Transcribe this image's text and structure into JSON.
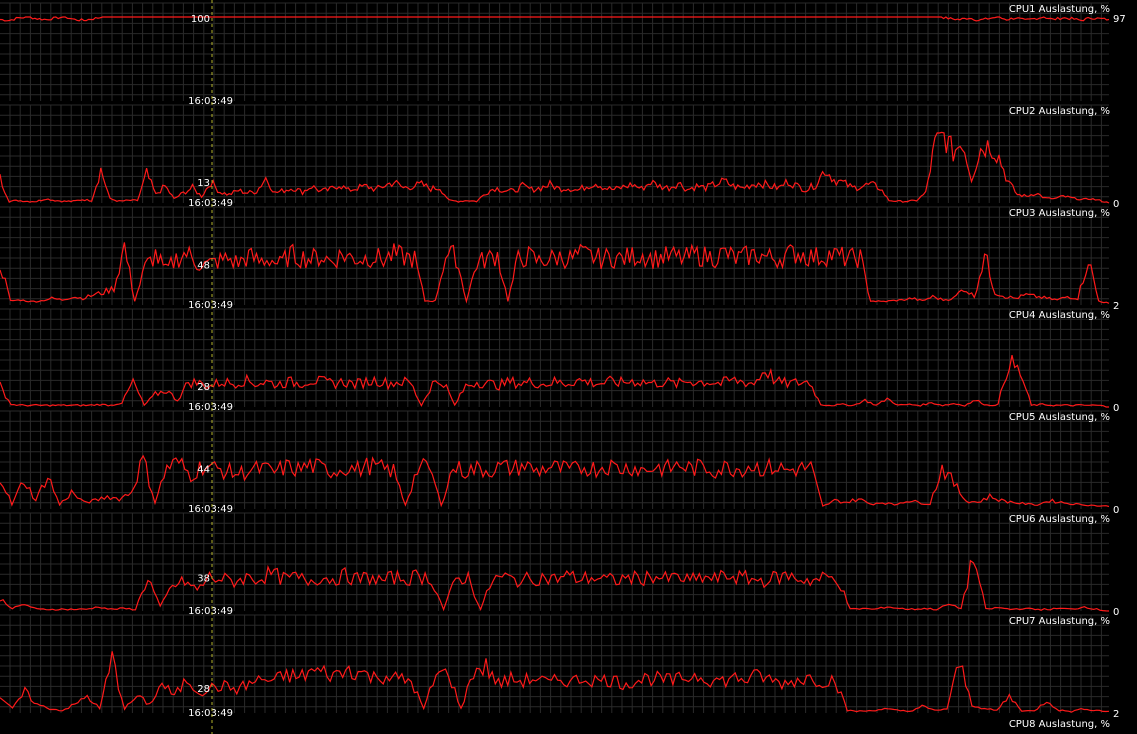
{
  "colors": {
    "background": "#000000",
    "grid": "#2a2a2a",
    "line": "#ff1a1a",
    "text": "#ffffff",
    "cursor": "#b5b52a"
  },
  "cursor": {
    "time": "16:03:49"
  },
  "chart_data": [
    {
      "type": "line",
      "title": "CPU1 Auslastung, %",
      "ylim": [
        0,
        100
      ],
      "current_value": "97",
      "cursor_value": "100",
      "cursor_time": "16:03:49",
      "grid": true,
      "profile": "flat",
      "series": [
        {
          "values": [
            97,
            96,
            99,
            100,
            98,
            97,
            99,
            100,
            97,
            96,
            98,
            100,
            100,
            100,
            100,
            100,
            100,
            100,
            100,
            100,
            100,
            100,
            100,
            100,
            100,
            100,
            100,
            100,
            100,
            100,
            100,
            100,
            100,
            100,
            100,
            100,
            100,
            100,
            100,
            100,
            100,
            100,
            100,
            100,
            100,
            100,
            100,
            100,
            100,
            100,
            100,
            100,
            100,
            100,
            100,
            100,
            100,
            100,
            100,
            100,
            100,
            100,
            100,
            100,
            100,
            100,
            100,
            100,
            100,
            100,
            100,
            100,
            100,
            100,
            100,
            100,
            100,
            100,
            100,
            100,
            100,
            100,
            100,
            100,
            100,
            100,
            100,
            100,
            100,
            100,
            100,
            100,
            100,
            100,
            100,
            100,
            100,
            100,
            100,
            100,
            100,
            100,
            98,
            97,
            99,
            96,
            98,
            100,
            97,
            99,
            96,
            98,
            100,
            97,
            99,
            98,
            96,
            99,
            98,
            97
          ]
        }
      ]
    },
    {
      "type": "line",
      "title": "CPU2 Auslastung, %",
      "ylim": [
        0,
        100
      ],
      "current_value": "0",
      "cursor_value": "13",
      "cursor_time": "16:03:49",
      "grid": true,
      "profile": "cpu2",
      "series": [
        {
          "values": [
            30,
            2,
            3,
            2,
            2,
            5,
            3,
            2,
            2,
            4,
            3,
            40,
            5,
            2,
            3,
            3,
            35,
            10,
            20,
            5,
            12,
            18,
            8,
            25,
            13,
            10,
            15,
            12,
            14,
            30,
            12,
            15,
            18,
            13,
            20,
            14,
            16,
            22,
            15,
            18,
            20,
            16,
            21,
            25,
            18,
            20,
            22,
            17,
            18,
            3,
            2,
            3,
            2,
            12,
            18,
            15,
            14,
            20,
            16,
            18,
            22,
            17,
            18,
            15,
            20,
            24,
            18,
            16,
            19,
            22,
            17,
            25,
            20,
            18,
            24,
            16,
            20,
            18,
            22,
            26,
            20,
            18,
            22,
            24,
            20,
            18,
            26,
            20,
            16,
            22,
            40,
            28,
            24,
            18,
            20,
            22,
            18,
            3,
            2,
            2,
            3,
            12,
            70,
            80,
            60,
            75,
            30,
            65,
            70,
            55,
            25,
            10,
            8,
            12,
            6,
            5,
            8,
            6,
            4,
            5,
            3,
            0
          ]
        }
      ]
    },
    {
      "type": "line",
      "title": "CPU3 Auslastung, %",
      "ylim": [
        0,
        100
      ],
      "current_value": "2",
      "cursor_value": "48",
      "cursor_time": "16:03:49",
      "grid": true,
      "profile": "cpu3",
      "series": [
        {
          "values": [
            50,
            5,
            6,
            4,
            5,
            8,
            6,
            10,
            8,
            12,
            15,
            20,
            70,
            5,
            45,
            60,
            40,
            55,
            62,
            50,
            48,
            52,
            55,
            50,
            58,
            52,
            55,
            48,
            60,
            57,
            55,
            58,
            52,
            60,
            56,
            55,
            58,
            54,
            60,
            57,
            55,
            5,
            5,
            60,
            58,
            5,
            50,
            55,
            60,
            5,
            55,
            58,
            52,
            55,
            57,
            55,
            60,
            58,
            55,
            57,
            55,
            58,
            60,
            55,
            57,
            58,
            55,
            60,
            58,
            57,
            62,
            55,
            58,
            60,
            57,
            55,
            60,
            62,
            58,
            57,
            60,
            58,
            55,
            57,
            5,
            4,
            5,
            6,
            8,
            5,
            10,
            6,
            8,
            20,
            10,
            60,
            15,
            10,
            8,
            12,
            10,
            8,
            6,
            10,
            8,
            55,
            5,
            2
          ]
        }
      ]
    },
    {
      "type": "line",
      "title": "CPU4 Auslastung, %",
      "ylim": [
        0,
        100
      ],
      "current_value": "0",
      "cursor_value": "28",
      "cursor_time": "16:03:49",
      "grid": true,
      "profile": "cpu4",
      "series": [
        {
          "values": [
            25,
            3,
            2,
            2,
            2,
            2,
            2,
            2,
            2,
            3,
            2,
            5,
            30,
            2,
            15,
            20,
            8,
            30,
            28,
            25,
            30,
            28,
            32,
            28,
            30,
            27,
            30,
            28,
            32,
            30,
            28,
            30,
            27,
            30,
            32,
            28,
            30,
            29,
            2,
            28,
            30,
            2,
            25,
            30,
            28,
            26,
            30,
            28,
            30,
            27,
            30,
            28,
            32,
            30,
            28,
            30,
            29,
            31,
            30,
            28,
            30,
            27,
            31,
            30,
            30,
            28,
            32,
            30,
            28,
            45,
            30,
            28,
            29,
            30,
            3,
            2,
            3,
            2,
            8,
            2,
            10,
            2,
            3,
            2,
            5,
            2,
            4,
            2,
            8,
            2,
            3,
            55,
            40,
            2,
            3,
            2,
            2,
            2,
            2,
            2,
            0
          ]
        }
      ]
    },
    {
      "type": "line",
      "title": "CPU5 Auslastung, %",
      "ylim": [
        0,
        100
      ],
      "current_value": "0",
      "cursor_value": "44",
      "cursor_time": "16:03:49",
      "grid": true,
      "profile": "cpu5",
      "series": [
        {
          "values": [
            40,
            5,
            35,
            10,
            40,
            5,
            20,
            8,
            10,
            15,
            12,
            20,
            60,
            8,
            50,
            55,
            40,
            52,
            48,
            45,
            42,
            46,
            48,
            44,
            50,
            47,
            52,
            48,
            45,
            50,
            47,
            52,
            48,
            45,
            5,
            48,
            50,
            5,
            50,
            45,
            48,
            46,
            50,
            48,
            52,
            45,
            50,
            48,
            46,
            50,
            48,
            52,
            48,
            50,
            46,
            50,
            48,
            52,
            48,
            50,
            46,
            50,
            48,
            52,
            48,
            50,
            46,
            48,
            50,
            3,
            10,
            8,
            12,
            6,
            8,
            5,
            10,
            8,
            6,
            50,
            30,
            10,
            8,
            15,
            10,
            8,
            6,
            5,
            10,
            8,
            6,
            5,
            4,
            3
          ]
        }
      ]
    },
    {
      "type": "line",
      "title": "CPU6 Auslastung, %",
      "ylim": [
        0,
        100
      ],
      "current_value": "0",
      "cursor_value": "38",
      "cursor_time": "16:03:49",
      "grid": true,
      "profile": "cpu6",
      "series": [
        {
          "values": [
            15,
            3,
            8,
            2,
            2,
            2,
            2,
            2,
            5,
            2,
            3,
            2,
            40,
            5,
            30,
            35,
            25,
            40,
            38,
            35,
            40,
            38,
            45,
            38,
            40,
            36,
            40,
            38,
            42,
            38,
            40,
            36,
            40,
            38,
            42,
            38,
            2,
            38,
            40,
            2,
            38,
            40,
            36,
            38,
            40,
            38,
            42,
            38,
            40,
            38,
            36,
            40,
            38,
            42,
            38,
            40,
            36,
            40,
            38,
            42,
            40,
            38,
            36,
            40,
            42,
            38,
            36,
            40,
            38,
            2,
            3,
            2,
            5,
            3,
            2,
            3,
            2,
            8,
            3,
            65,
            2,
            4,
            2,
            3,
            2,
            2,
            3,
            2,
            5,
            2,
            0
          ]
        }
      ]
    },
    {
      "type": "line",
      "title": "CPU7 Auslastung, %",
      "ylim": [
        0,
        100
      ],
      "current_value": "2",
      "cursor_value": "28",
      "cursor_time": "16:03:49",
      "grid": true,
      "profile": "cpu7",
      "series": [
        {
          "values": [
            20,
            5,
            25,
            10,
            5,
            3,
            10,
            20,
            5,
            65,
            5,
            20,
            10,
            35,
            20,
            40,
            25,
            30,
            32,
            28,
            35,
            40,
            38,
            45,
            42,
            50,
            48,
            45,
            52,
            48,
            42,
            45,
            40,
            38,
            5,
            45,
            48,
            5,
            50,
            55,
            35,
            40,
            38,
            42,
            35,
            40,
            38,
            42,
            38,
            40,
            35,
            38,
            42,
            40,
            38,
            42,
            45,
            40,
            38,
            42,
            40,
            45,
            38,
            35,
            40,
            42,
            38,
            40,
            3,
            2,
            3,
            5,
            3,
            2,
            8,
            3,
            5,
            60,
            10,
            5,
            3,
            20,
            3,
            2,
            15,
            3,
            2,
            5,
            3,
            2
          ]
        }
      ]
    }
  ],
  "trailing_label": "CPU8 Auslastung, %"
}
